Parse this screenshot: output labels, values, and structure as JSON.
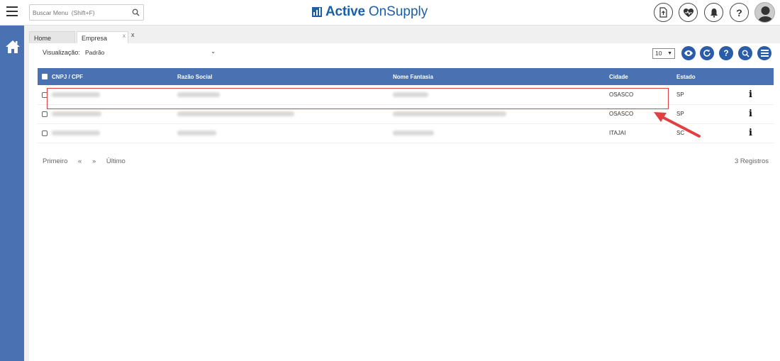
{
  "header": {
    "search_placeholder": "Buscar Menu  (Shift+F)",
    "logo_bold": "Active",
    "logo_light": "OnSupply",
    "brand_color": "#1b5fa8",
    "icons": [
      "upload-doc-icon",
      "heart-pulse-icon",
      "bell-icon",
      "help-icon",
      "user-avatar-icon"
    ]
  },
  "sidebar": {
    "color": "#4a72b2",
    "icons": [
      "home-icon"
    ]
  },
  "tabs": [
    {
      "label": "Home",
      "close": ""
    },
    {
      "label": "Empresa",
      "close": "x"
    }
  ],
  "tabs_close_all": "x",
  "toolbar": {
    "view_label": "Visualização:",
    "view_value": "Padrão",
    "page_size": "10",
    "buttons": [
      "eye-icon",
      "refresh-icon",
      "help-icon",
      "search-icon",
      "menu-icon"
    ]
  },
  "table": {
    "columns": [
      "CNPJ / CPF",
      "Razão Social",
      "Nome Fantasia",
      "Cidade",
      "Estado"
    ],
    "rows": [
      {
        "cidade": "OSASCO",
        "estado": "SP"
      },
      {
        "cidade": "OSASCO",
        "estado": "SP"
      },
      {
        "cidade": "ITAJAI",
        "estado": "SC"
      }
    ]
  },
  "pager": {
    "first": "Primeiro",
    "prev": "«",
    "next": "»",
    "last": "Último",
    "count": "3 Registros"
  },
  "annotation_color": "#e04040"
}
